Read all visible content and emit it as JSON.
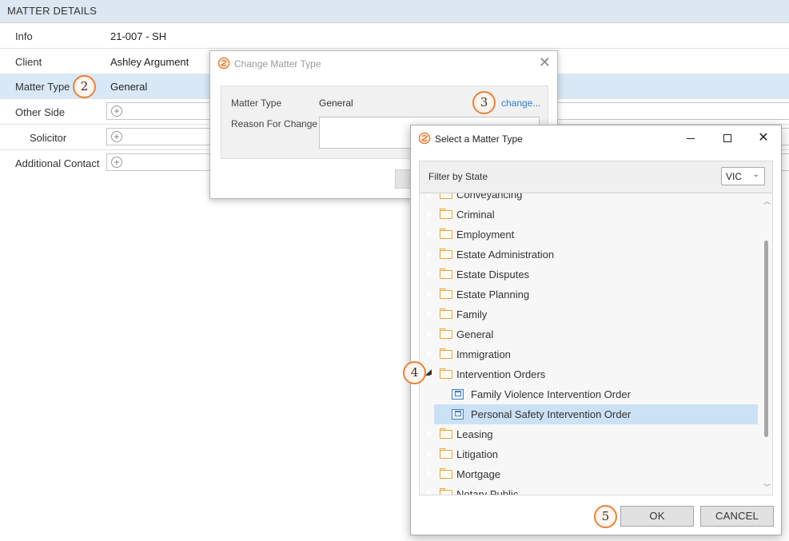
{
  "matter_details": {
    "header": "MATTER DETAILS",
    "rows": [
      {
        "label": "Info",
        "value": "21-007 - SH"
      },
      {
        "label": "Client",
        "value": "Ashley Argument"
      },
      {
        "label": "Matter Type",
        "value": "General"
      },
      {
        "label": "Other Side",
        "value": ""
      },
      {
        "label": "Solicitor",
        "value": ""
      },
      {
        "label": "Additional Contact",
        "value": ""
      }
    ]
  },
  "callouts": {
    "c2": "2",
    "c3": "3",
    "c4": "4",
    "c5": "5"
  },
  "change_dialog": {
    "title": "Change Matter Type",
    "matter_type_label": "Matter Type",
    "matter_type_value": "General",
    "change_link": "change...",
    "reason_label": "Reason For Change",
    "reason_value": ""
  },
  "select_dialog": {
    "title": "Select a Matter Type",
    "filter_label": "Filter by State",
    "state_value": "VIC",
    "tree": {
      "partial_top": "Conveyancing",
      "items": [
        "Criminal",
        "Employment",
        "Estate Administration",
        "Estate Disputes",
        "Estate Planning",
        "Family",
        "General",
        "Immigration",
        "Intervention Orders"
      ],
      "children": [
        "Family Violence Intervention Order",
        "Personal Safety Intervention Order"
      ],
      "after": [
        "Leasing",
        "Litigation",
        "Mortgage"
      ],
      "partial_bottom": "Notary Public"
    },
    "ok_label": "OK",
    "cancel_label": "CANCEL"
  },
  "colors": {
    "accent": "#e8823a",
    "selection": "#cbe1f5",
    "link": "#2f7fd1",
    "folder": "#e8a33a"
  }
}
